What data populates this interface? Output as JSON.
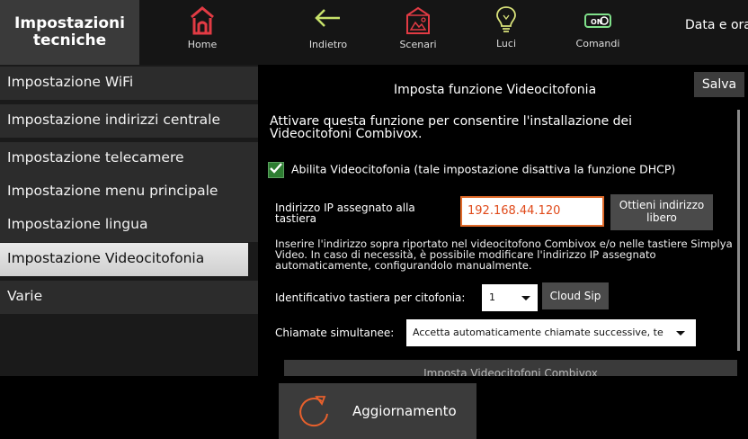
{
  "header": {
    "title": "Impostazioni tecniche",
    "nav": [
      {
        "label": "Home",
        "icon": "home-icon",
        "color": "#e23b44"
      },
      {
        "label": "Indietro",
        "icon": "back-arrow-icon",
        "color": "#c7e26a"
      },
      {
        "label": "Scenari",
        "icon": "scenarios-icon",
        "color": "#e23b44"
      },
      {
        "label": "Luci",
        "icon": "light-bulb-icon",
        "color": "#d9e27a"
      },
      {
        "label": "Comandi",
        "icon": "on-off-switch-icon",
        "color": "#7fe08a"
      }
    ],
    "date_time": "Data e ora"
  },
  "sidebar": {
    "items": [
      {
        "label": "Impostazione WiFi"
      },
      {
        "label": "Impostazione indirizzi centrale"
      },
      {
        "label": "Impostazione telecamere"
      },
      {
        "label": "Impostazione menu principale"
      },
      {
        "label": "Impostazione lingua"
      },
      {
        "label": "Impostazione Videocitofonia",
        "active": true
      },
      {
        "label": "Varie"
      }
    ]
  },
  "panel": {
    "title": "Imposta funzione Videocitofonia",
    "save_label": "Salva",
    "intro": "Attivare questa funzione per consentire l'installazione dei Videocitofoni Combivox.",
    "enable_checkbox": {
      "checked": true,
      "label": "Abilita Videocitofonia (tale impostazione disattiva la funzione DHCP)"
    },
    "ip": {
      "label": "Indirizzo IP assegnato alla tastiera",
      "value": "192.168.44.120",
      "obtain_button": "Ottieni indirizzo libero"
    },
    "note": "Inserire l'indirizzo sopra riportato nel videocitofono Combivox e/o nelle tastiere Simplya Video. In caso di necessità, è possibile modificare l'indirizzo IP assegnato automaticamente, configurandolo manualmente.",
    "keypad_id": {
      "label": "Identificativo tastiera per citofonia:",
      "value": "1",
      "cloud_button": "Cloud Sip"
    },
    "simultaneous_calls": {
      "label": "Chiamate simultanee:",
      "value": "Accetta automaticamente chiamate successive, te"
    },
    "bottom_button": "Imposta Videocitofoni Combivox"
  },
  "footer": {
    "update_label": "Aggiornamento",
    "update_icon": "refresh-icon",
    "accent_color": "#e8602c"
  }
}
